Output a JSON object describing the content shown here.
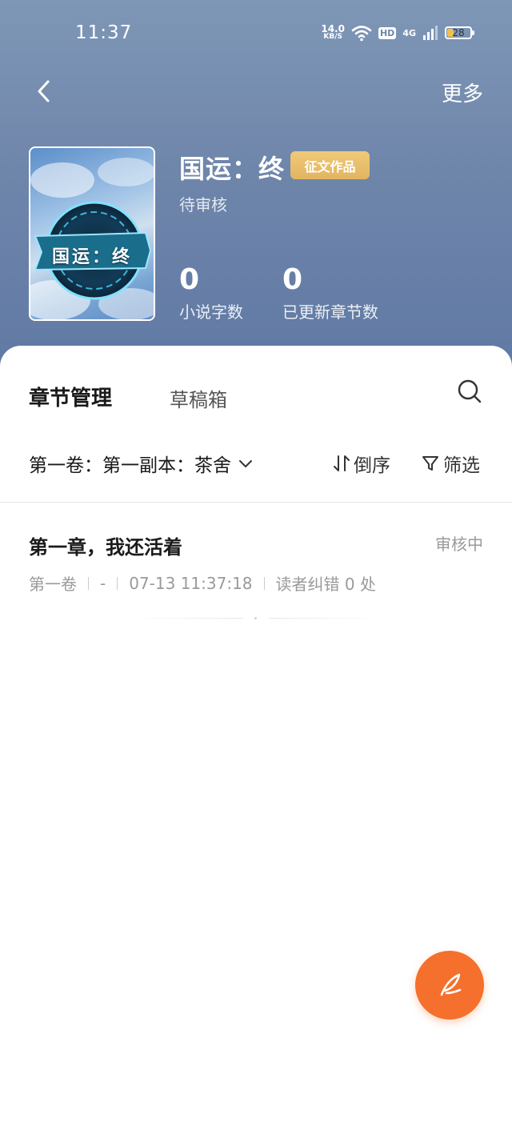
{
  "status_bar": {
    "time": "11:37",
    "net_speed": "14.0",
    "net_unit": "KB/S",
    "hd": "HD",
    "network": "4G",
    "battery": "28"
  },
  "header": {
    "back_icon": "chevron-left-icon",
    "more_label": "更多"
  },
  "book": {
    "cover_text": "国运：终",
    "title": "国运：终",
    "badge": "征文作品",
    "status": "待审核",
    "stats": [
      {
        "value": "0",
        "label": "小说字数"
      },
      {
        "value": "0",
        "label": "已更新章节数"
      }
    ]
  },
  "tabs": {
    "active": "章节管理",
    "draft": "草稿箱",
    "search_icon": "search-icon"
  },
  "toolbar": {
    "volume": "第一卷：第一副本：茶舍",
    "sort_label": "倒序",
    "filter_label": "筛选"
  },
  "chapters": [
    {
      "title": "第一章，我还活着",
      "status": "审核中",
      "volume": "第一卷",
      "dash": "-",
      "time": "07-13 11:37:18",
      "reader_fix": "读者纠错 0 处"
    }
  ],
  "fab": {
    "icon": "quill-pen-icon"
  },
  "colors": {
    "accent": "#f4702c",
    "badge": "#e2b560",
    "header_bg": "#6f86ab"
  }
}
